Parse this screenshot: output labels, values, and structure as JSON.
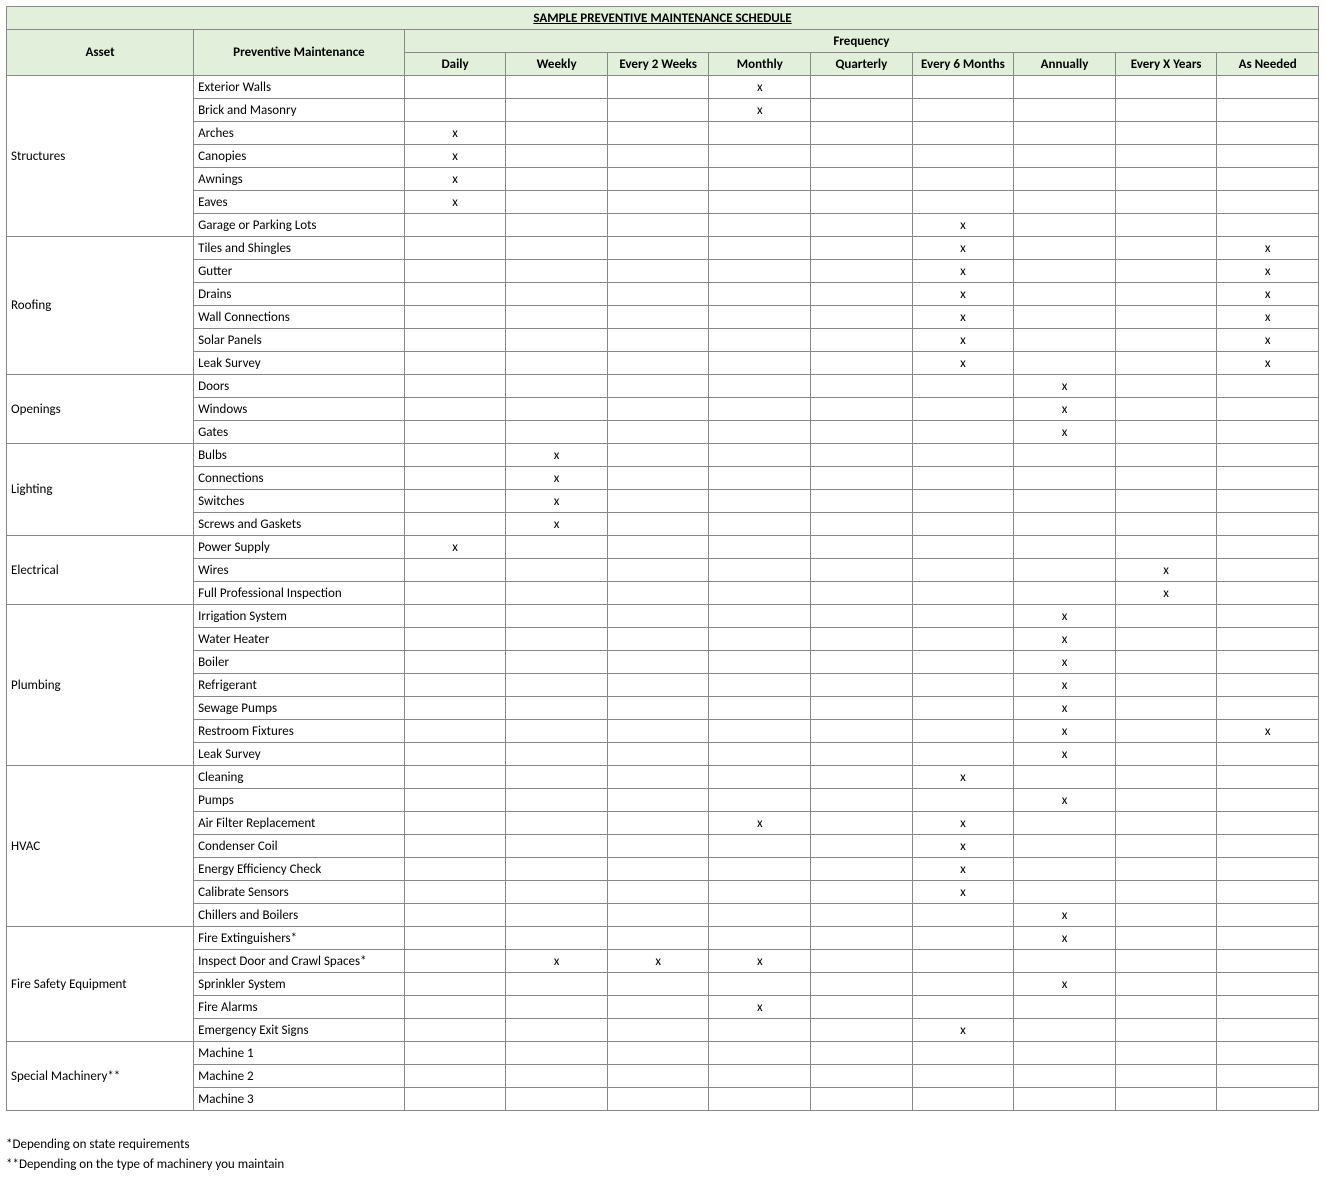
{
  "title": "SAMPLE PREVENTIVE MAINTENANCE SCHEDULE",
  "headers": {
    "asset": "Asset",
    "pm": "Preventive Maintenance",
    "frequency": "Frequency",
    "cols": [
      "Daily",
      "Weekly",
      "Every 2 Weeks",
      "Monthly",
      "Quarterly",
      "Every 6 Months",
      "Annually",
      "Every X Years",
      "As Needed"
    ]
  },
  "mark": "x",
  "groups": [
    {
      "asset": "Structures",
      "items": [
        {
          "name": "Exterior Walls",
          "freq": [
            "",
            "",
            "",
            "x",
            "",
            "",
            "",
            "",
            ""
          ]
        },
        {
          "name": "Brick and Masonry",
          "freq": [
            "",
            "",
            "",
            "x",
            "",
            "",
            "",
            "",
            ""
          ]
        },
        {
          "name": "Arches",
          "freq": [
            "x",
            "",
            "",
            "",
            "",
            "",
            "",
            "",
            ""
          ]
        },
        {
          "name": "Canopies",
          "freq": [
            "x",
            "",
            "",
            "",
            "",
            "",
            "",
            "",
            ""
          ]
        },
        {
          "name": "Awnings",
          "freq": [
            "x",
            "",
            "",
            "",
            "",
            "",
            "",
            "",
            ""
          ]
        },
        {
          "name": "Eaves",
          "freq": [
            "x",
            "",
            "",
            "",
            "",
            "",
            "",
            "",
            ""
          ]
        },
        {
          "name": "Garage or Parking Lots",
          "freq": [
            "",
            "",
            "",
            "",
            "",
            "x",
            "",
            "",
            ""
          ]
        }
      ]
    },
    {
      "asset": "Roofing",
      "items": [
        {
          "name": "Tiles and Shingles",
          "freq": [
            "",
            "",
            "",
            "",
            "",
            "x",
            "",
            "",
            "x"
          ]
        },
        {
          "name": "Gutter",
          "freq": [
            "",
            "",
            "",
            "",
            "",
            "x",
            "",
            "",
            "x"
          ]
        },
        {
          "name": "Drains",
          "freq": [
            "",
            "",
            "",
            "",
            "",
            "x",
            "",
            "",
            "x"
          ]
        },
        {
          "name": "Wall Connections",
          "freq": [
            "",
            "",
            "",
            "",
            "",
            "x",
            "",
            "",
            "x"
          ]
        },
        {
          "name": "Solar Panels",
          "freq": [
            "",
            "",
            "",
            "",
            "",
            "x",
            "",
            "",
            "x"
          ]
        },
        {
          "name": "Leak Survey",
          "freq": [
            "",
            "",
            "",
            "",
            "",
            "x",
            "",
            "",
            "x"
          ]
        }
      ]
    },
    {
      "asset": "Openings",
      "items": [
        {
          "name": "Doors",
          "freq": [
            "",
            "",
            "",
            "",
            "",
            "",
            "x",
            "",
            ""
          ]
        },
        {
          "name": "Windows",
          "freq": [
            "",
            "",
            "",
            "",
            "",
            "",
            "x",
            "",
            ""
          ]
        },
        {
          "name": "Gates",
          "freq": [
            "",
            "",
            "",
            "",
            "",
            "",
            "x",
            "",
            ""
          ]
        }
      ]
    },
    {
      "asset": "Lighting",
      "items": [
        {
          "name": "Bulbs",
          "freq": [
            "",
            "x",
            "",
            "",
            "",
            "",
            "",
            "",
            ""
          ]
        },
        {
          "name": "Connections",
          "freq": [
            "",
            "x",
            "",
            "",
            "",
            "",
            "",
            "",
            ""
          ]
        },
        {
          "name": "Switches",
          "freq": [
            "",
            "x",
            "",
            "",
            "",
            "",
            "",
            "",
            ""
          ]
        },
        {
          "name": "Screws and Gaskets",
          "freq": [
            "",
            "x",
            "",
            "",
            "",
            "",
            "",
            "",
            ""
          ]
        }
      ]
    },
    {
      "asset": "Electrical",
      "items": [
        {
          "name": "Power Supply",
          "freq": [
            "x",
            "",
            "",
            "",
            "",
            "",
            "",
            "",
            ""
          ]
        },
        {
          "name": "Wires",
          "freq": [
            "",
            "",
            "",
            "",
            "",
            "",
            "",
            "x",
            ""
          ]
        },
        {
          "name": "Full Professional Inspection",
          "freq": [
            "",
            "",
            "",
            "",
            "",
            "",
            "",
            "x",
            ""
          ]
        }
      ]
    },
    {
      "asset": "Plumbing",
      "items": [
        {
          "name": "Irrigation System",
          "freq": [
            "",
            "",
            "",
            "",
            "",
            "",
            "x",
            "",
            ""
          ]
        },
        {
          "name": "Water Heater",
          "freq": [
            "",
            "",
            "",
            "",
            "",
            "",
            "x",
            "",
            ""
          ]
        },
        {
          "name": "Boiler",
          "freq": [
            "",
            "",
            "",
            "",
            "",
            "",
            "x",
            "",
            ""
          ]
        },
        {
          "name": "Refrigerant",
          "freq": [
            "",
            "",
            "",
            "",
            "",
            "",
            "x",
            "",
            ""
          ]
        },
        {
          "name": "Sewage Pumps",
          "freq": [
            "",
            "",
            "",
            "",
            "",
            "",
            "x",
            "",
            ""
          ]
        },
        {
          "name": "Restroom Fixtures",
          "freq": [
            "",
            "",
            "",
            "",
            "",
            "",
            "x",
            "",
            "x"
          ]
        },
        {
          "name": "Leak Survey",
          "freq": [
            "",
            "",
            "",
            "",
            "",
            "",
            "x",
            "",
            ""
          ]
        }
      ]
    },
    {
      "asset": "HVAC",
      "items": [
        {
          "name": "Cleaning",
          "freq": [
            "",
            "",
            "",
            "",
            "",
            "x",
            "",
            "",
            ""
          ]
        },
        {
          "name": "Pumps",
          "freq": [
            "",
            "",
            "",
            "",
            "",
            "",
            "x",
            "",
            ""
          ]
        },
        {
          "name": "Air Filter Replacement",
          "freq": [
            "",
            "",
            "",
            "x",
            "",
            "x",
            "",
            "",
            ""
          ]
        },
        {
          "name": "Condenser Coil",
          "freq": [
            "",
            "",
            "",
            "",
            "",
            "x",
            "",
            "",
            ""
          ]
        },
        {
          "name": "Energy Efficiency Check",
          "freq": [
            "",
            "",
            "",
            "",
            "",
            "x",
            "",
            "",
            ""
          ]
        },
        {
          "name": "Calibrate Sensors",
          "freq": [
            "",
            "",
            "",
            "",
            "",
            "x",
            "",
            "",
            ""
          ]
        },
        {
          "name": "Chillers and Boilers",
          "freq": [
            "",
            "",
            "",
            "",
            "",
            "",
            "x",
            "",
            ""
          ]
        }
      ]
    },
    {
      "asset": "Fire Safety Equipment",
      "items": [
        {
          "name": "Fire Extinguishers*",
          "freq": [
            "",
            "",
            "",
            "",
            "",
            "",
            "x",
            "",
            ""
          ]
        },
        {
          "name": "Inspect Door and Crawl Spaces*",
          "freq": [
            "",
            "x",
            "x",
            "x",
            "",
            "",
            "",
            "",
            ""
          ]
        },
        {
          "name": "Sprinkler System",
          "freq": [
            "",
            "",
            "",
            "",
            "",
            "",
            "x",
            "",
            ""
          ]
        },
        {
          "name": "Fire Alarms",
          "freq": [
            "",
            "",
            "",
            "x",
            "",
            "",
            "",
            "",
            ""
          ]
        },
        {
          "name": "Emergency Exit Signs",
          "freq": [
            "",
            "",
            "",
            "",
            "",
            "x",
            "",
            "",
            ""
          ]
        }
      ]
    },
    {
      "asset": "Special Machinery**",
      "items": [
        {
          "name": "Machine 1",
          "freq": [
            "",
            "",
            "",
            "",
            "",
            "",
            "",
            "",
            ""
          ]
        },
        {
          "name": "Machine 2",
          "freq": [
            "",
            "",
            "",
            "",
            "",
            "",
            "",
            "",
            ""
          ]
        },
        {
          "name": "Machine 3",
          "freq": [
            "",
            "",
            "",
            "",
            "",
            "",
            "",
            "",
            ""
          ]
        }
      ]
    }
  ],
  "footnotes": [
    "*Depending on state requirements",
    "**Depending on the type of machinery you maintain"
  ]
}
